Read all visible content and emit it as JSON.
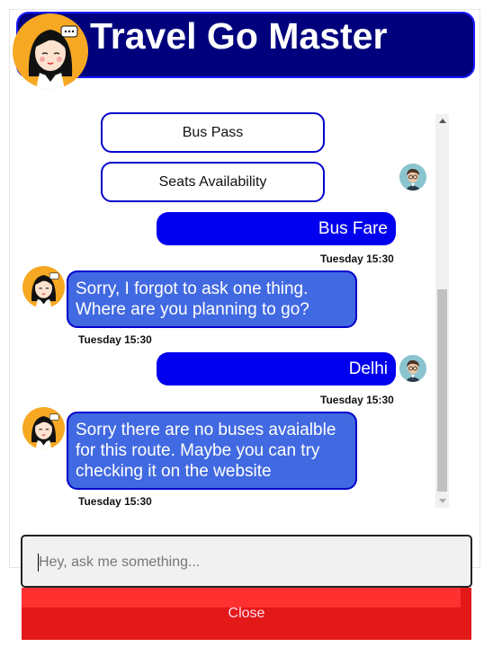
{
  "header": {
    "title": "Travel Go Master"
  },
  "messages": {
    "options": [
      "Bus Pass",
      "Seats Availability"
    ],
    "user1": {
      "text": "Bus Fare",
      "time": "Tuesday 15:30"
    },
    "bot1": {
      "text": "Sorry, I forgot to ask one thing. Where are you planning to go?",
      "time": "Tuesday 15:30"
    },
    "user2": {
      "text": "Delhi",
      "time": "Tuesday 15:30"
    },
    "bot2": {
      "text": "Sorry there are no buses avaialble for this route. Maybe you can try checking it on the website",
      "time": "Tuesday 15:30"
    }
  },
  "input": {
    "placeholder": "Hey, ask me something..."
  },
  "footer": {
    "close_label": "Close"
  },
  "colors": {
    "header_bg": "#00007d",
    "user_bubble": "#0000ee",
    "bot_bubble": "#4169e1",
    "close_bg": "#e31818",
    "avatar_bg": "#f7a823"
  },
  "icons": {
    "bot": "assistant-avatar-icon",
    "user": "user-avatar-icon"
  }
}
